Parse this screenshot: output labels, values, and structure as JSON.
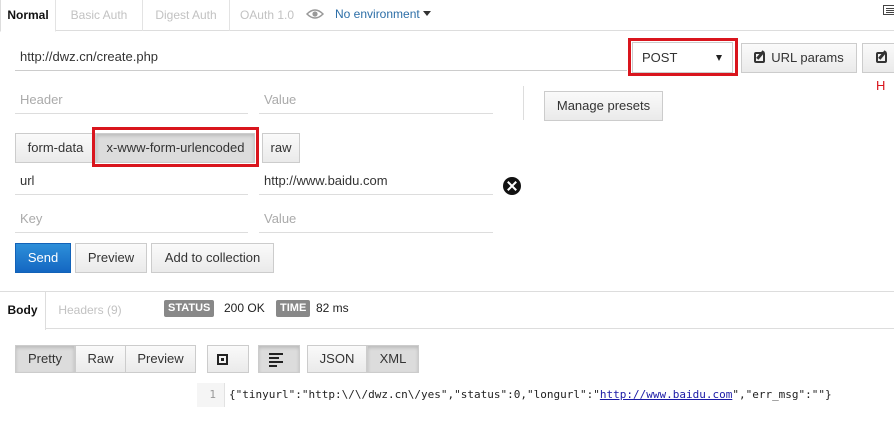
{
  "auth_tabs": [
    {
      "label": "Normal",
      "active": true
    },
    {
      "label": "Basic Auth",
      "active": false
    },
    {
      "label": "Digest Auth",
      "active": false
    },
    {
      "label": "OAuth 1.0",
      "active": false
    }
  ],
  "environment": {
    "label": "No environment",
    "icon": "eye-icon"
  },
  "request": {
    "url": "http://dwz.cn/create.php",
    "method": "POST",
    "url_params_label": "URL params",
    "headers_label_partial": "H"
  },
  "header_fields": {
    "key_placeholder": "Header",
    "value_placeholder": "Value"
  },
  "manage_presets_label": "Manage presets",
  "body_modes": [
    {
      "label": "form-data",
      "active": false
    },
    {
      "label": "x-www-form-urlencoded",
      "active": true
    },
    {
      "label": "raw",
      "active": false
    }
  ],
  "params": [
    {
      "key": "url",
      "value": "http://www.baidu.com"
    }
  ],
  "param_placeholders": {
    "key": "Key",
    "value": "Value"
  },
  "actions": {
    "send": "Send",
    "preview": "Preview",
    "add_to_collection": "Add to collection"
  },
  "response": {
    "tabs": [
      {
        "label": "Body",
        "active": true
      },
      {
        "label": "Headers (9)",
        "active": false
      }
    ],
    "status_label": "STATUS",
    "status_value": "200 OK",
    "time_label": "TIME",
    "time_value": "82 ms",
    "view_modes": [
      "Pretty",
      "Raw",
      "Preview"
    ],
    "active_view": "Pretty",
    "formats": [
      "JSON",
      "XML"
    ],
    "active_format": "XML",
    "line_number": "1",
    "code_before": "{\"tinyurl\":\"http:\\/\\/dwz.cn\\/yes\",\"status\":0,\"longurl\":\"",
    "code_link": "http://www.baidu.com",
    "code_after": "\",\"err_msg\":\"\"}"
  },
  "colors": {
    "highlight_red": "#d9151d",
    "primary_blue": "#1467c2",
    "link_blue": "#2c6ea7"
  }
}
